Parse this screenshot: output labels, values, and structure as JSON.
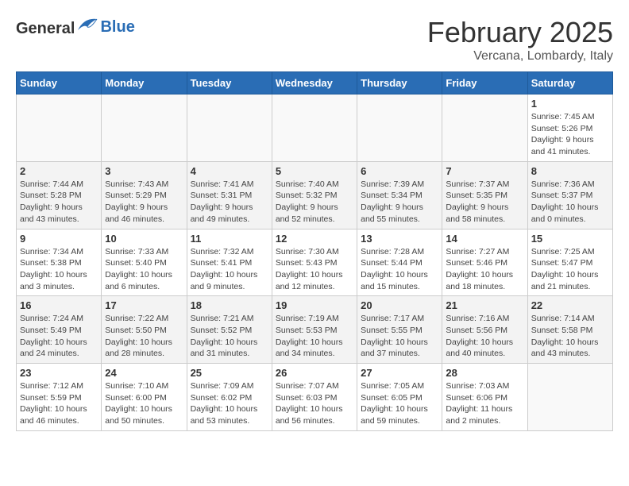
{
  "header": {
    "logo_general": "General",
    "logo_blue": "Blue",
    "month_title": "February 2025",
    "subtitle": "Vercana, Lombardy, Italy"
  },
  "days_of_week": [
    "Sunday",
    "Monday",
    "Tuesday",
    "Wednesday",
    "Thursday",
    "Friday",
    "Saturday"
  ],
  "weeks": [
    {
      "days": [
        {
          "number": "",
          "info": ""
        },
        {
          "number": "",
          "info": ""
        },
        {
          "number": "",
          "info": ""
        },
        {
          "number": "",
          "info": ""
        },
        {
          "number": "",
          "info": ""
        },
        {
          "number": "",
          "info": ""
        },
        {
          "number": "1",
          "info": "Sunrise: 7:45 AM\nSunset: 5:26 PM\nDaylight: 9 hours and 41 minutes."
        }
      ]
    },
    {
      "days": [
        {
          "number": "2",
          "info": "Sunrise: 7:44 AM\nSunset: 5:28 PM\nDaylight: 9 hours and 43 minutes."
        },
        {
          "number": "3",
          "info": "Sunrise: 7:43 AM\nSunset: 5:29 PM\nDaylight: 9 hours and 46 minutes."
        },
        {
          "number": "4",
          "info": "Sunrise: 7:41 AM\nSunset: 5:31 PM\nDaylight: 9 hours and 49 minutes."
        },
        {
          "number": "5",
          "info": "Sunrise: 7:40 AM\nSunset: 5:32 PM\nDaylight: 9 hours and 52 minutes."
        },
        {
          "number": "6",
          "info": "Sunrise: 7:39 AM\nSunset: 5:34 PM\nDaylight: 9 hours and 55 minutes."
        },
        {
          "number": "7",
          "info": "Sunrise: 7:37 AM\nSunset: 5:35 PM\nDaylight: 9 hours and 58 minutes."
        },
        {
          "number": "8",
          "info": "Sunrise: 7:36 AM\nSunset: 5:37 PM\nDaylight: 10 hours and 0 minutes."
        }
      ]
    },
    {
      "days": [
        {
          "number": "9",
          "info": "Sunrise: 7:34 AM\nSunset: 5:38 PM\nDaylight: 10 hours and 3 minutes."
        },
        {
          "number": "10",
          "info": "Sunrise: 7:33 AM\nSunset: 5:40 PM\nDaylight: 10 hours and 6 minutes."
        },
        {
          "number": "11",
          "info": "Sunrise: 7:32 AM\nSunset: 5:41 PM\nDaylight: 10 hours and 9 minutes."
        },
        {
          "number": "12",
          "info": "Sunrise: 7:30 AM\nSunset: 5:43 PM\nDaylight: 10 hours and 12 minutes."
        },
        {
          "number": "13",
          "info": "Sunrise: 7:28 AM\nSunset: 5:44 PM\nDaylight: 10 hours and 15 minutes."
        },
        {
          "number": "14",
          "info": "Sunrise: 7:27 AM\nSunset: 5:46 PM\nDaylight: 10 hours and 18 minutes."
        },
        {
          "number": "15",
          "info": "Sunrise: 7:25 AM\nSunset: 5:47 PM\nDaylight: 10 hours and 21 minutes."
        }
      ]
    },
    {
      "days": [
        {
          "number": "16",
          "info": "Sunrise: 7:24 AM\nSunset: 5:49 PM\nDaylight: 10 hours and 24 minutes."
        },
        {
          "number": "17",
          "info": "Sunrise: 7:22 AM\nSunset: 5:50 PM\nDaylight: 10 hours and 28 minutes."
        },
        {
          "number": "18",
          "info": "Sunrise: 7:21 AM\nSunset: 5:52 PM\nDaylight: 10 hours and 31 minutes."
        },
        {
          "number": "19",
          "info": "Sunrise: 7:19 AM\nSunset: 5:53 PM\nDaylight: 10 hours and 34 minutes."
        },
        {
          "number": "20",
          "info": "Sunrise: 7:17 AM\nSunset: 5:55 PM\nDaylight: 10 hours and 37 minutes."
        },
        {
          "number": "21",
          "info": "Sunrise: 7:16 AM\nSunset: 5:56 PM\nDaylight: 10 hours and 40 minutes."
        },
        {
          "number": "22",
          "info": "Sunrise: 7:14 AM\nSunset: 5:58 PM\nDaylight: 10 hours and 43 minutes."
        }
      ]
    },
    {
      "days": [
        {
          "number": "23",
          "info": "Sunrise: 7:12 AM\nSunset: 5:59 PM\nDaylight: 10 hours and 46 minutes."
        },
        {
          "number": "24",
          "info": "Sunrise: 7:10 AM\nSunset: 6:00 PM\nDaylight: 10 hours and 50 minutes."
        },
        {
          "number": "25",
          "info": "Sunrise: 7:09 AM\nSunset: 6:02 PM\nDaylight: 10 hours and 53 minutes."
        },
        {
          "number": "26",
          "info": "Sunrise: 7:07 AM\nSunset: 6:03 PM\nDaylight: 10 hours and 56 minutes."
        },
        {
          "number": "27",
          "info": "Sunrise: 7:05 AM\nSunset: 6:05 PM\nDaylight: 10 hours and 59 minutes."
        },
        {
          "number": "28",
          "info": "Sunrise: 7:03 AM\nSunset: 6:06 PM\nDaylight: 11 hours and 2 minutes."
        },
        {
          "number": "",
          "info": ""
        }
      ]
    }
  ]
}
